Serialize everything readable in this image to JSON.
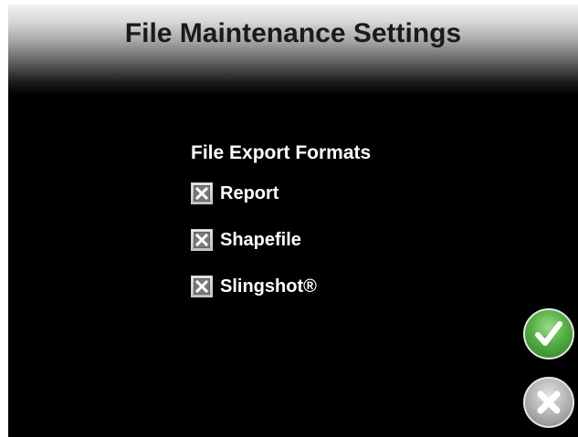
{
  "header": {
    "title": "File Maintenance Settings"
  },
  "export_formats": {
    "heading": "File Export Formats",
    "options": [
      {
        "label": "Report",
        "checked": true
      },
      {
        "label": "Shapefile",
        "checked": true
      },
      {
        "label": "Slingshot®",
        "checked": true
      }
    ]
  },
  "actions": {
    "confirm_icon": "checkmark-icon",
    "cancel_icon": "x-icon"
  },
  "colors": {
    "background": "#000000",
    "confirm": "#52b043",
    "cancel": "#b3b3b3"
  }
}
